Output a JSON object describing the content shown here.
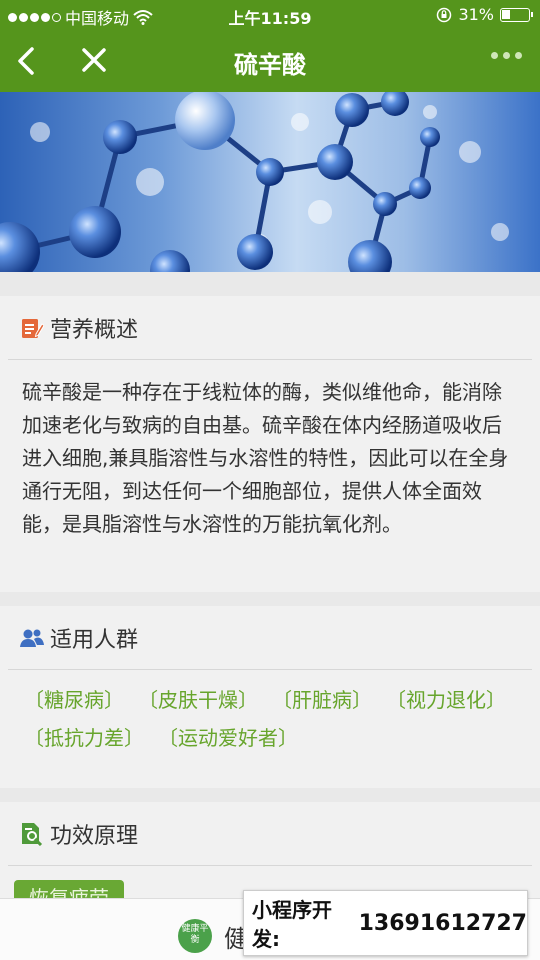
{
  "status_bar": {
    "carrier": "中国移动",
    "time": "上午11:59",
    "battery": "31%"
  },
  "navbar": {
    "title": "硫辛酸"
  },
  "overview": {
    "heading": "营养概述",
    "text": "硫辛酸是一种存在于线粒体的酶，类似维他命，能消除加速老化与致病的自由基。硫辛酸在体内经肠道吸收后进入细胞,兼具脂溶性与水溶性的特性，因此可以在全身通行无阻，到达任何一个细胞部位，提供人体全面效能，是具脂溶性与水溶性的万能抗氧化剂。"
  },
  "audience": {
    "heading": "适用人群",
    "tags": [
      "〔糖尿病〕",
      "〔皮肤干燥〕",
      "〔肝脏病〕",
      "〔视力退化〕",
      "〔抵抗力差〕",
      "〔运动爱好者〕"
    ]
  },
  "principle": {
    "heading": "功效原理",
    "button": "恢复疲劳"
  },
  "bottom_bar": {
    "logo": "健康平衡",
    "brand": "健"
  },
  "ad": {
    "label": "小程序开发:",
    "phone": "13691612727"
  },
  "colors": {
    "nav_green": "#55951c",
    "tag_green": "#67a52c",
    "icon_orange": "#e4683a",
    "icon_blue": "#3f6fc2",
    "icon_green": "#4f9a3a"
  },
  "icons": [
    "back-icon",
    "close-icon",
    "more-icon",
    "wifi-icon",
    "orientation-lock-icon",
    "battery-icon",
    "pencil-note-icon",
    "people-icon",
    "document-search-icon"
  ]
}
